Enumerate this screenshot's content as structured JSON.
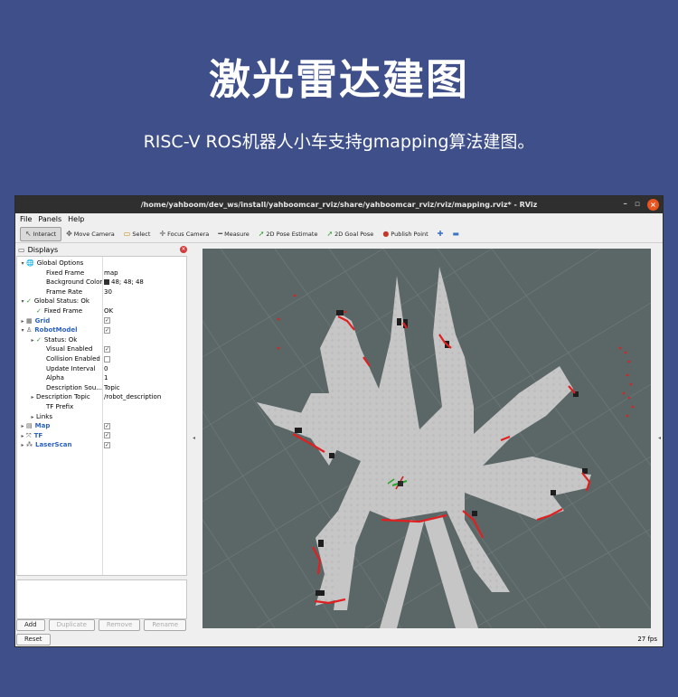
{
  "hero": {
    "title": "激光雷达建图",
    "subtitle": "RISC-V ROS机器人小车支持gmapping算法建图。"
  },
  "window": {
    "title": "/home/yahboom/dev_ws/install/yahboomcar_rviz/share/yahboomcar_rviz/rviz/mapping.rviz* - RViz",
    "minimize": "–",
    "maximize": "▫",
    "close": "×"
  },
  "menu": [
    "File",
    "Panels",
    "Help"
  ],
  "toolbar": [
    {
      "label": "Interact",
      "icon": "cursor-icon",
      "glyph": "↖",
      "color": ""
    },
    {
      "label": "Move Camera",
      "icon": "move-camera-icon",
      "glyph": "✥",
      "color": ""
    },
    {
      "label": "Select",
      "icon": "select-icon",
      "glyph": "▭",
      "color": "yellow"
    },
    {
      "label": "Focus Camera",
      "icon": "focus-camera-icon",
      "glyph": "✛",
      "color": ""
    },
    {
      "label": "Measure",
      "icon": "measure-icon",
      "glyph": "━",
      "color": ""
    },
    {
      "label": "2D Pose Estimate",
      "icon": "pose-estimate-icon",
      "glyph": "➚",
      "color": "green"
    },
    {
      "label": "2D Goal Pose",
      "icon": "goal-pose-icon",
      "glyph": "➚",
      "color": "green"
    },
    {
      "label": "Publish Point",
      "icon": "publish-point-icon",
      "glyph": "●",
      "color": "red"
    },
    {
      "label": "",
      "icon": "add-tool-icon",
      "glyph": "✚",
      "color": "blue"
    },
    {
      "label": "",
      "icon": "remove-tool-icon",
      "glyph": "▬",
      "color": "blue"
    }
  ],
  "displays": {
    "title": "Displays",
    "rows": [
      {
        "indent": 0,
        "arrow": "▾",
        "icon": "globe-icon",
        "glyph": "🌐",
        "key": "Global Options",
        "value": "",
        "style": ""
      },
      {
        "indent": 2,
        "arrow": "",
        "icon": "",
        "glyph": "",
        "key": "Fixed Frame",
        "value": "map",
        "style": ""
      },
      {
        "indent": 2,
        "arrow": "",
        "icon": "",
        "glyph": "",
        "key": "Background Color",
        "value": "48; 48; 48",
        "style": "swatch"
      },
      {
        "indent": 2,
        "arrow": "",
        "icon": "",
        "glyph": "",
        "key": "Frame Rate",
        "value": "30",
        "style": ""
      },
      {
        "indent": 0,
        "arrow": "▾",
        "icon": "check-icon",
        "glyph": "✓",
        "key": "Global Status: Ok",
        "value": "",
        "style": ""
      },
      {
        "indent": 1,
        "arrow": "",
        "icon": "check-icon",
        "glyph": "✓",
        "key": "Fixed Frame",
        "value": "OK",
        "style": ""
      },
      {
        "indent": 0,
        "arrow": "▸",
        "icon": "grid-icon",
        "glyph": "▦",
        "key": "Grid",
        "value": "✓",
        "style": "blue cb"
      },
      {
        "indent": 0,
        "arrow": "▾",
        "icon": "robot-model-icon",
        "glyph": "♙",
        "key": "RobotModel",
        "value": "✓",
        "style": "blue cb"
      },
      {
        "indent": 1,
        "arrow": "▸",
        "icon": "check-icon",
        "glyph": "✓",
        "key": "Status: Ok",
        "value": "",
        "style": ""
      },
      {
        "indent": 2,
        "arrow": "",
        "icon": "",
        "glyph": "",
        "key": "Visual Enabled",
        "value": "✓",
        "style": "cb"
      },
      {
        "indent": 2,
        "arrow": "",
        "icon": "",
        "glyph": "",
        "key": "Collision Enabled",
        "value": "",
        "style": "cb"
      },
      {
        "indent": 2,
        "arrow": "",
        "icon": "",
        "glyph": "",
        "key": "Update Interval",
        "value": "0",
        "style": ""
      },
      {
        "indent": 2,
        "arrow": "",
        "icon": "",
        "glyph": "",
        "key": "Alpha",
        "value": "1",
        "style": ""
      },
      {
        "indent": 2,
        "arrow": "",
        "icon": "",
        "glyph": "",
        "key": "Description Sou...",
        "value": "Topic",
        "style": ""
      },
      {
        "indent": 1,
        "arrow": "▸",
        "icon": "",
        "glyph": "",
        "key": "Description Topic",
        "value": "/robot_description",
        "style": ""
      },
      {
        "indent": 2,
        "arrow": "",
        "icon": "",
        "glyph": "",
        "key": "TF Prefix",
        "value": "",
        "style": ""
      },
      {
        "indent": 1,
        "arrow": "▸",
        "icon": "",
        "glyph": "",
        "key": "Links",
        "value": "",
        "style": ""
      },
      {
        "indent": 0,
        "arrow": "▸",
        "icon": "map-icon",
        "glyph": "▤",
        "key": "Map",
        "value": "✓",
        "style": "blue cb"
      },
      {
        "indent": 0,
        "arrow": "▸",
        "icon": "tf-icon",
        "glyph": "⤧",
        "key": "TF",
        "value": "✓",
        "style": "blue cb"
      },
      {
        "indent": 0,
        "arrow": "▸",
        "icon": "laserscan-icon",
        "glyph": "⁂",
        "key": "LaserScan",
        "value": "✓",
        "style": "blue cb"
      }
    ]
  },
  "buttons": {
    "add": "Add",
    "duplicate": "Duplicate",
    "remove": "Remove",
    "rename": "Rename",
    "reset": "Reset"
  },
  "status": {
    "fps": "27 fps"
  },
  "colors": {
    "page_bg": "#3e4f8a",
    "viewport_bg": "#5b6666",
    "free_space": "#c6c6c6",
    "laser_hits": "#e02020",
    "obstacles": "#1e1e1e"
  }
}
